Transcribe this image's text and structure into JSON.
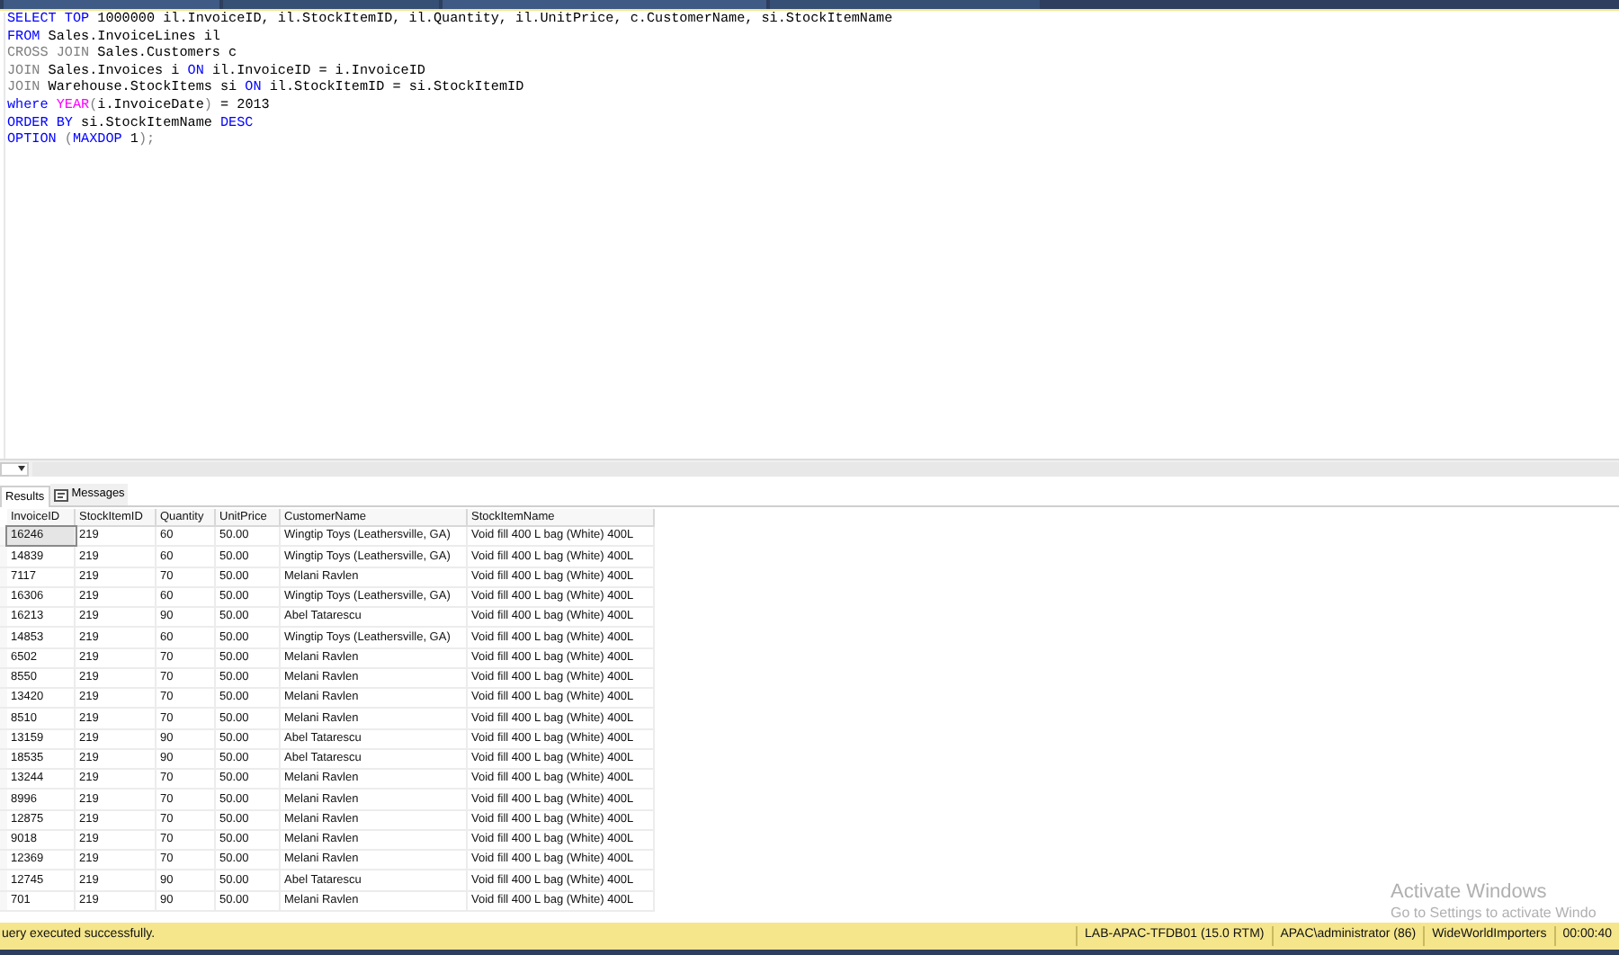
{
  "editor": {
    "lines": [
      [
        {
          "kind": "keyword",
          "text": "SELECT TOP"
        },
        {
          "kind": "plain",
          "text": " 1000000 il.InvoiceID, il.StockItemID, il.Quantity, il.UnitPrice, c.CustomerName, si.StockItemName"
        }
      ],
      [
        {
          "kind": "keyword",
          "text": "FROM"
        },
        {
          "kind": "plain",
          "text": " Sales.InvoiceLines il"
        }
      ],
      [
        {
          "kind": "gray",
          "text": "CROSS JOIN"
        },
        {
          "kind": "plain",
          "text": " Sales.Customers c"
        }
      ],
      [
        {
          "kind": "gray",
          "text": "JOIN"
        },
        {
          "kind": "plain",
          "text": " Sales.Invoices i "
        },
        {
          "kind": "keyword",
          "text": "ON"
        },
        {
          "kind": "plain",
          "text": " il.InvoiceID = i.InvoiceID"
        }
      ],
      [
        {
          "kind": "gray",
          "text": "JOIN"
        },
        {
          "kind": "plain",
          "text": " Warehouse.StockItems si "
        },
        {
          "kind": "keyword",
          "text": "ON"
        },
        {
          "kind": "plain",
          "text": " il.StockItemID = si.StockItemID"
        }
      ],
      [
        {
          "kind": "keyword",
          "text": "where"
        },
        {
          "kind": "function",
          "text": " YEAR"
        },
        {
          "kind": "gray",
          "text": "("
        },
        {
          "kind": "plain",
          "text": "i.InvoiceDate"
        },
        {
          "kind": "gray",
          "text": ")"
        },
        {
          "kind": "plain",
          "text": " = 2013"
        }
      ],
      [
        {
          "kind": "keyword",
          "text": "ORDER BY"
        },
        {
          "kind": "plain",
          "text": " si.StockItemName "
        },
        {
          "kind": "keyword",
          "text": "DESC"
        }
      ],
      [
        {
          "kind": "keyword",
          "text": "OPTION"
        },
        {
          "kind": "gray",
          "text": " ("
        },
        {
          "kind": "keyword",
          "text": "MAXDOP"
        },
        {
          "kind": "plain",
          "text": " 1"
        },
        {
          "kind": "gray",
          "text": ");"
        }
      ]
    ]
  },
  "result_tabs": [
    {
      "label": "Results",
      "selected": true
    },
    {
      "label": "Messages",
      "selected": false
    }
  ],
  "table": {
    "columns": [
      "InvoiceID",
      "StockItemID",
      "Quantity",
      "UnitPrice",
      "CustomerName",
      "StockItemName"
    ],
    "rows": [
      {
        "cells": [
          "16246",
          "219",
          "60",
          "50.00",
          "Wingtip Toys (Leathersville, GA)",
          "Void fill 400 L bag (White) 400L"
        ],
        "selected": true
      },
      {
        "cells": [
          "14839",
          "219",
          "60",
          "50.00",
          "Wingtip Toys (Leathersville, GA)",
          "Void fill 400 L bag (White) 400L"
        ],
        "selected": false
      },
      {
        "cells": [
          "7117",
          "219",
          "70",
          "50.00",
          "Melani Ravlen",
          "Void fill 400 L bag (White) 400L"
        ],
        "selected": false
      },
      {
        "cells": [
          "16306",
          "219",
          "60",
          "50.00",
          "Wingtip Toys (Leathersville, GA)",
          "Void fill 400 L bag (White) 400L"
        ],
        "selected": false
      },
      {
        "cells": [
          "16213",
          "219",
          "90",
          "50.00",
          "Abel Tatarescu",
          "Void fill 400 L bag (White) 400L"
        ],
        "selected": false
      },
      {
        "cells": [
          "14853",
          "219",
          "60",
          "50.00",
          "Wingtip Toys (Leathersville, GA)",
          "Void fill 400 L bag (White) 400L"
        ],
        "selected": false
      },
      {
        "cells": [
          "6502",
          "219",
          "70",
          "50.00",
          "Melani Ravlen",
          "Void fill 400 L bag (White) 400L"
        ],
        "selected": false
      },
      {
        "cells": [
          "8550",
          "219",
          "70",
          "50.00",
          "Melani Ravlen",
          "Void fill 400 L bag (White) 400L"
        ],
        "selected": false
      },
      {
        "cells": [
          "13420",
          "219",
          "70",
          "50.00",
          "Melani Ravlen",
          "Void fill 400 L bag (White) 400L"
        ],
        "selected": false
      },
      {
        "cells": [
          "8510",
          "219",
          "70",
          "50.00",
          "Melani Ravlen",
          "Void fill 400 L bag (White) 400L"
        ],
        "selected": false
      },
      {
        "cells": [
          "13159",
          "219",
          "90",
          "50.00",
          "Abel Tatarescu",
          "Void fill 400 L bag (White) 400L"
        ],
        "selected": false
      },
      {
        "cells": [
          "18535",
          "219",
          "90",
          "50.00",
          "Abel Tatarescu",
          "Void fill 400 L bag (White) 400L"
        ],
        "selected": false
      },
      {
        "cells": [
          "13244",
          "219",
          "70",
          "50.00",
          "Melani Ravlen",
          "Void fill 400 L bag (White) 400L"
        ],
        "selected": false
      },
      {
        "cells": [
          "8996",
          "219",
          "70",
          "50.00",
          "Melani Ravlen",
          "Void fill 400 L bag (White) 400L"
        ],
        "selected": false
      },
      {
        "cells": [
          "12875",
          "219",
          "70",
          "50.00",
          "Melani Ravlen",
          "Void fill 400 L bag (White) 400L"
        ],
        "selected": false
      },
      {
        "cells": [
          "9018",
          "219",
          "70",
          "50.00",
          "Melani Ravlen",
          "Void fill 400 L bag (White) 400L"
        ],
        "selected": false
      },
      {
        "cells": [
          "12369",
          "219",
          "70",
          "50.00",
          "Melani Ravlen",
          "Void fill 400 L bag (White) 400L"
        ],
        "selected": false
      },
      {
        "cells": [
          "12745",
          "219",
          "90",
          "50.00",
          "Abel Tatarescu",
          "Void fill 400 L bag (White) 400L"
        ],
        "selected": false
      },
      {
        "cells": [
          "701",
          "219",
          "90",
          "50.00",
          "Melani Ravlen",
          "Void fill 400 L bag (White) 400L"
        ],
        "selected": false
      }
    ]
  },
  "activation_notice": {
    "title": "Activate Windows",
    "subtitle": "Go to Settings to activate Windo"
  },
  "status_bar": {
    "message": "uery executed successfully.",
    "items": [
      "LAB-APAC-TFDB01 (15.0 RTM)",
      "APAC\\administrator (86)",
      "WideWorldImporters",
      "00:00:40"
    ]
  }
}
